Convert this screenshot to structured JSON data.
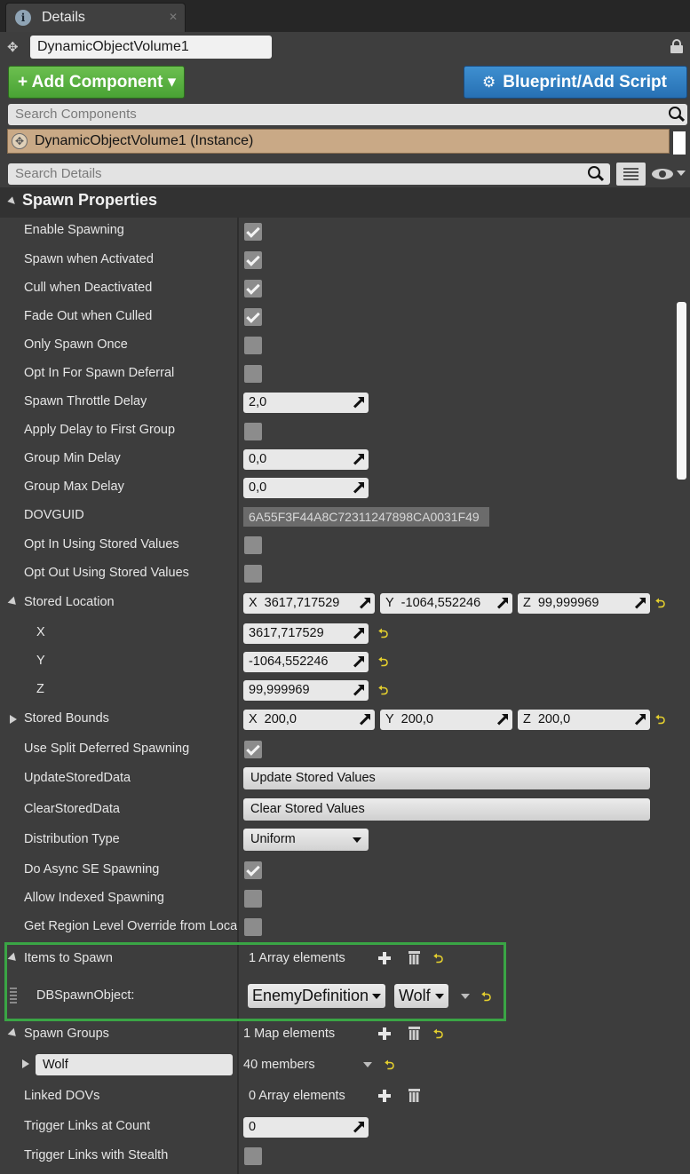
{
  "tab": {
    "icon": "info-icon",
    "label": "Details",
    "close": "✕"
  },
  "actor": {
    "name": "DynamicObjectVolume1"
  },
  "toolbar": {
    "add_component": "+ Add Component ▾",
    "blueprint": "Blueprint/Add Script"
  },
  "search_components": {
    "placeholder": "Search Components"
  },
  "component_instance": "DynamicObjectVolume1 (Instance)",
  "search_details": {
    "placeholder": "Search Details"
  },
  "category": "Spawn Properties",
  "labels": {
    "enable_spawning": "Enable Spawning",
    "spawn_when_activated": "Spawn when Activated",
    "cull_when_deactivated": "Cull when Deactivated",
    "fade_out_when_culled": "Fade Out when Culled",
    "only_spawn_once": "Only Spawn Once",
    "opt_in_spawn_deferral": "Opt In For Spawn Deferral",
    "spawn_throttle_delay": "Spawn Throttle Delay",
    "apply_delay_first_group": "Apply Delay to First Group",
    "group_min_delay": "Group Min Delay",
    "group_max_delay": "Group Max Delay",
    "dovguid": "DOVGUID",
    "opt_in_stored": "Opt In Using Stored Values",
    "opt_out_stored": "Opt Out Using Stored Values",
    "stored_location": "Stored Location",
    "x": "X",
    "y": "Y",
    "z": "Z",
    "stored_bounds": "Stored Bounds",
    "use_split_deferred": "Use Split Deferred Spawning",
    "update_stored_data": "UpdateStoredData",
    "clear_stored_data": "ClearStoredData",
    "distribution_type": "Distribution Type",
    "do_async_se": "Do Async SE Spawning",
    "allow_indexed": "Allow Indexed Spawning",
    "get_region_level": "Get Region Level Override from Location",
    "items_to_spawn": "Items to Spawn",
    "db_spawn_object": "DBSpawnObject:",
    "spawn_groups": "Spawn Groups",
    "linked_dovs": "Linked DOVs",
    "trigger_links_count": "Trigger Links at Count",
    "trigger_links_stealth": "Trigger Links with Stealth"
  },
  "checks": {
    "enable_spawning": true,
    "spawn_when_activated": true,
    "cull_when_deactivated": true,
    "fade_out_when_culled": true,
    "only_spawn_once": false,
    "opt_in_spawn_deferral": false,
    "apply_delay_first_group": false,
    "opt_in_stored": false,
    "opt_out_stored": false,
    "use_split_deferred": true,
    "do_async_se": true,
    "allow_indexed": false,
    "get_region_level": false,
    "trigger_links_stealth": false
  },
  "values": {
    "spawn_throttle_delay": "2,0",
    "group_min_delay": "0,0",
    "group_max_delay": "0,0",
    "dovguid": "6A55F3F44A8C72311247898CA0031F49",
    "stored_location": {
      "x": "3617,717529",
      "y": "-1064,552246",
      "z": "99,999969"
    },
    "stored_bounds": {
      "x": "200,0",
      "y": "200,0",
      "z": "200,0"
    },
    "distribution_type": "Uniform",
    "trigger_links_count": "0"
  },
  "axis": {
    "x": "X",
    "y": "Y",
    "z": "Z"
  },
  "buttons": {
    "update_stored_values": "Update Stored Values",
    "clear_stored_values": "Clear Stored Values"
  },
  "items_to_spawn": {
    "count": "1 Array elements",
    "class": "EnemyDefinition",
    "value": "Wolf"
  },
  "spawn_groups": {
    "count": "1 Map elements",
    "key": "Wolf",
    "members": "40 members"
  },
  "linked_dovs": {
    "count": "0 Array elements"
  },
  "reset_glyph": "⮌",
  "colors": {
    "add_button": "#4fa83a",
    "blueprint_button": "#2f7fc4",
    "highlight": "#3aa545",
    "reset": "#e4cf2e"
  }
}
